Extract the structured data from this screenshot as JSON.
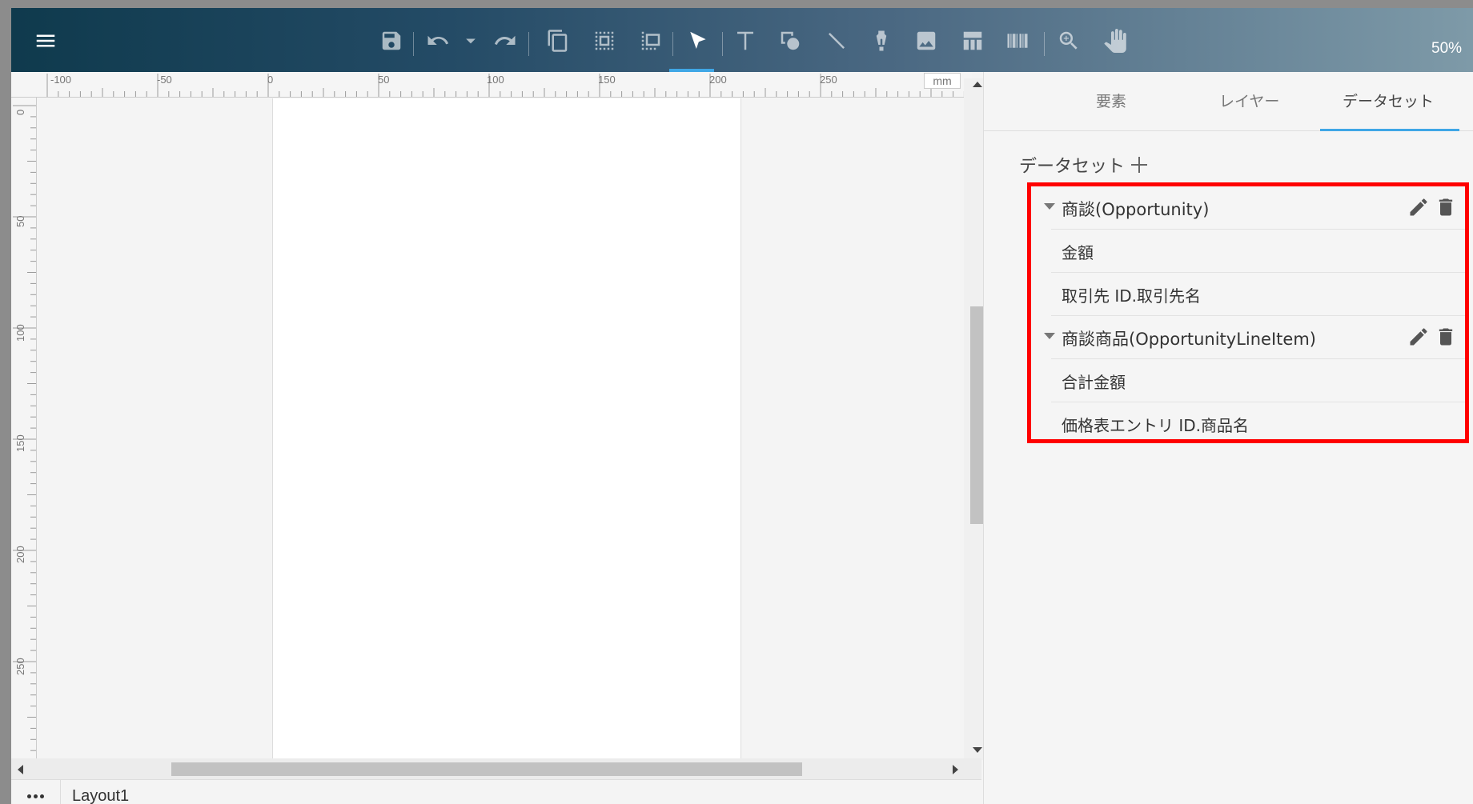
{
  "toolbar": {
    "zoom": "50%",
    "icons": [
      "menu-icon",
      "save-icon",
      "undo-icon",
      "dropdown-icon",
      "redo-icon",
      "copy-icon",
      "select-box-icon",
      "group-icon",
      "pointer-icon",
      "text-icon",
      "shape-icon",
      "line-icon",
      "pen-icon",
      "image-icon",
      "table-icon",
      "barcode-icon",
      "zoom-icon",
      "hand-icon"
    ]
  },
  "ruler": {
    "horizontal": [
      "-100",
      "-50",
      "0",
      "50",
      "100",
      "150",
      "200",
      "250"
    ],
    "vertical": [
      "0",
      "50",
      "100",
      "150",
      "200",
      "250"
    ],
    "unit": "mm"
  },
  "footer": {
    "layout_tab": "Layout1"
  },
  "panel": {
    "tabs": [
      "要素",
      "レイヤー",
      "データセット"
    ],
    "active_tab": "データセット",
    "dataset_header": "データセット",
    "datasets": [
      {
        "name": "商談(Opportunity)",
        "fields": [
          "金額",
          "取引先 ID.取引先名"
        ]
      },
      {
        "name": "商談商品(OpportunityLineItem)",
        "fields": [
          "合計金額",
          "価格表エントリ ID.商品名"
        ]
      }
    ]
  },
  "colors": {
    "accent": "#3fa7e6",
    "highlight_border": "#ff0000"
  }
}
